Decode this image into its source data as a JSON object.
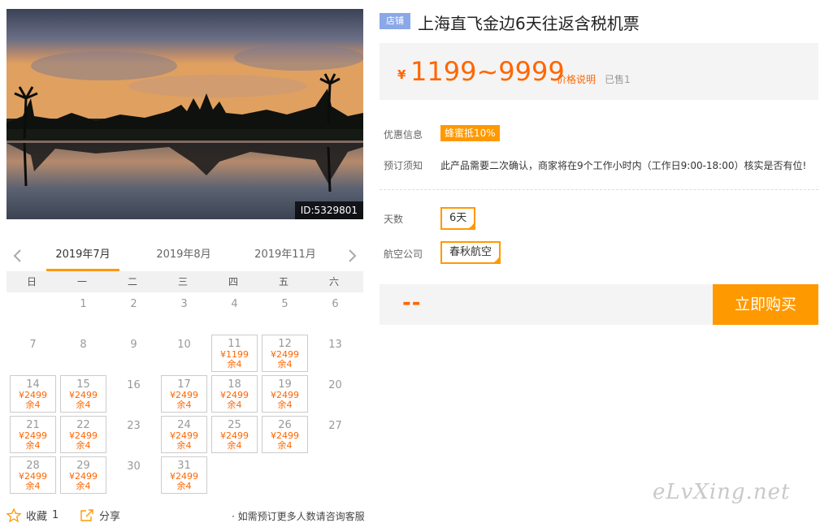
{
  "product": {
    "store_badge": "店铺",
    "title": "上海直飞金边6天往返含税机票",
    "image_id": "ID:5329801"
  },
  "pricing": {
    "currency": "¥",
    "range": "1199~9999",
    "note_link": "价格说明",
    "sold": "已售1"
  },
  "info": {
    "promo_label": "优惠信息",
    "promo_tag": "蜂蜜抵10%",
    "notice_label": "预订须知",
    "notice_text": "此产品需要二次确认，商家将在9个工作小时内（工作日9:00-18:00）核实是否有位!"
  },
  "options": {
    "days_label": "天数",
    "days_value": "6天",
    "airline_label": "航空公司",
    "airline_value": "春秋航空"
  },
  "purchase": {
    "total": "--",
    "buy_label": "立即购买"
  },
  "calendar": {
    "months": [
      "2019年7月",
      "2019年8月",
      "2019年11月"
    ],
    "active_month": 0,
    "weekdays": [
      "日",
      "一",
      "二",
      "三",
      "四",
      "五",
      "六"
    ],
    "weeks": [
      [
        {
          "d": ""
        },
        {
          "d": "1"
        },
        {
          "d": "2"
        },
        {
          "d": "3"
        },
        {
          "d": "4"
        },
        {
          "d": "5"
        },
        {
          "d": "6"
        }
      ],
      [
        {
          "d": "7"
        },
        {
          "d": "8"
        },
        {
          "d": "9"
        },
        {
          "d": "10"
        },
        {
          "d": "11",
          "price": "¥1199",
          "stock": "余4"
        },
        {
          "d": "12",
          "price": "¥2499",
          "stock": "余4"
        },
        {
          "d": "13"
        }
      ],
      [
        {
          "d": "14",
          "price": "¥2499",
          "stock": "余4"
        },
        {
          "d": "15",
          "price": "¥2499",
          "stock": "余4"
        },
        {
          "d": "16"
        },
        {
          "d": "17",
          "price": "¥2499",
          "stock": "余4"
        },
        {
          "d": "18",
          "price": "¥2499",
          "stock": "余4"
        },
        {
          "d": "19",
          "price": "¥2499",
          "stock": "余4"
        },
        {
          "d": "20"
        }
      ],
      [
        {
          "d": "21",
          "price": "¥2499",
          "stock": "余4"
        },
        {
          "d": "22",
          "price": "¥2499",
          "stock": "余4"
        },
        {
          "d": "23"
        },
        {
          "d": "24",
          "price": "¥2499",
          "stock": "余4"
        },
        {
          "d": "25",
          "price": "¥2499",
          "stock": "余4"
        },
        {
          "d": "26",
          "price": "¥2499",
          "stock": "余4"
        },
        {
          "d": "27"
        }
      ],
      [
        {
          "d": "28",
          "price": "¥2499",
          "stock": "余4"
        },
        {
          "d": "29",
          "price": "¥2499",
          "stock": "余4"
        },
        {
          "d": "30"
        },
        {
          "d": "31",
          "price": "¥2499",
          "stock": "余4"
        },
        {
          "d": ""
        },
        {
          "d": ""
        },
        {
          "d": ""
        }
      ]
    ]
  },
  "footer": {
    "favorite_label": "收藏",
    "favorite_count": "1",
    "share_label": "分享",
    "contact_note": "· 如需预订更多人数请咨询客服"
  },
  "watermark": "eLvXing.net",
  "colors": {
    "accent": "#ff9900",
    "price": "#ff6600",
    "badge": "#8aa8e8"
  }
}
